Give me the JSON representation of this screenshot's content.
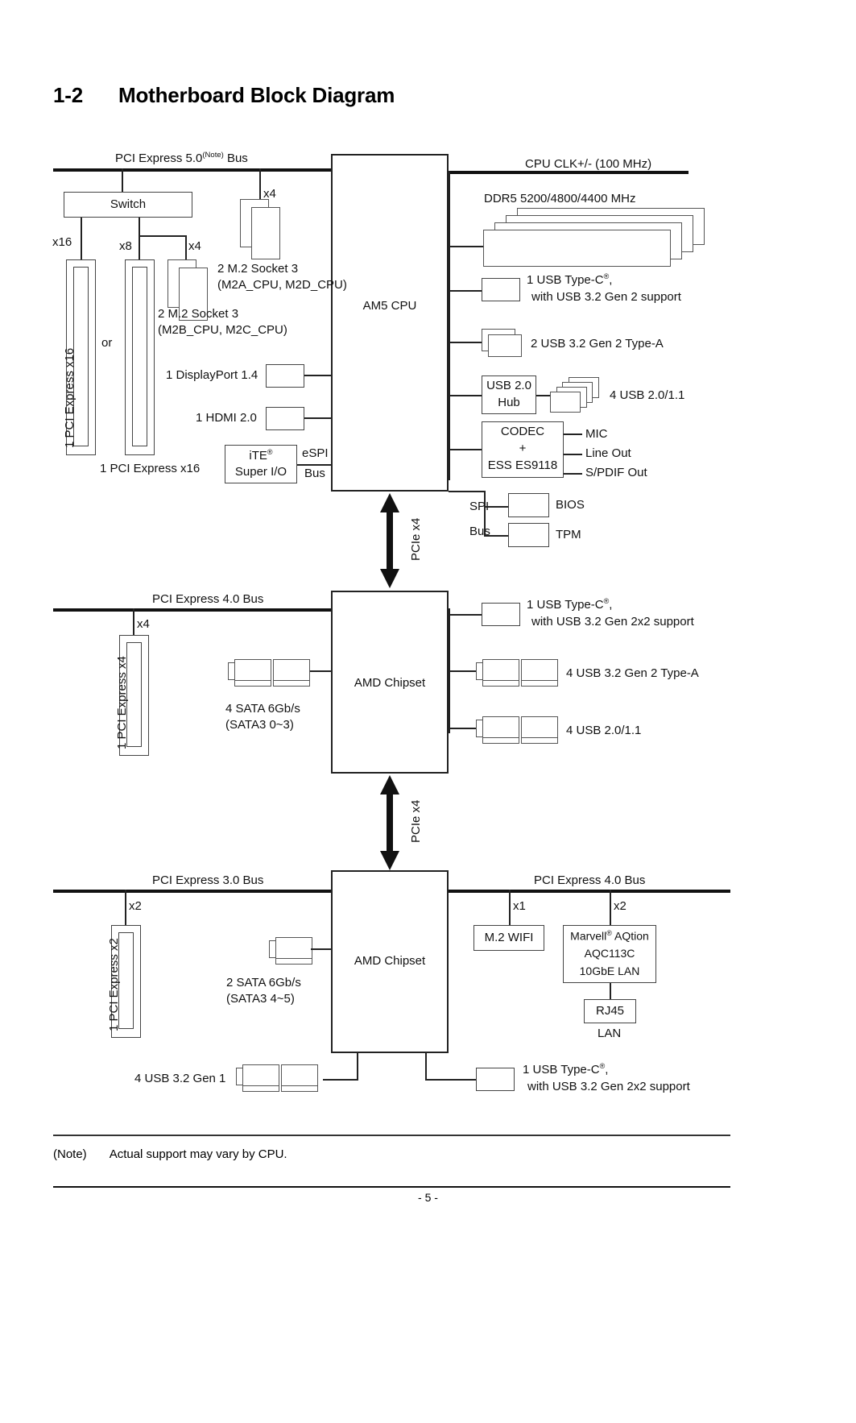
{
  "page": {
    "section_number": "1-2",
    "title": "Motherboard Block Diagram",
    "note_label": "(Note)",
    "note_text": "Actual support may vary by CPU.",
    "page_number": "- 5 -"
  },
  "cpu_section": {
    "bus_left_label": "PCI Express 5.0",
    "bus_left_label_sup": "(Note)",
    "bus_left_label_tail": " Bus",
    "bus_right_label": "CPU CLK+/- (100 MHz)",
    "cpu_block": "AM5 CPU",
    "switch_block": "Switch",
    "lane_x16": "x16",
    "lane_x8": "x8",
    "lane_x4_switch": "x4",
    "lane_x4_bus": "x4",
    "or_label": "or",
    "slot1_label": "1 PCI Express x16",
    "slot2_label": "1 PCI Express x16",
    "m2_a_line1": "2 M.2 Socket 3",
    "m2_a_line2": "(M2A_CPU, M2D_CPU)",
    "m2_b_line1": "2 M.2 Socket 3",
    "m2_b_line2": "(M2B_CPU, M2C_CPU)",
    "displayport": "1 DisplayPort 1.4",
    "hdmi": "1 HDMI 2.0",
    "super_io_line1": "iTE",
    "super_io_sup": "®",
    "super_io_line2": "Super I/O",
    "espi_line1": "eSPI",
    "espi_line2": "Bus",
    "memory": "DDR5 5200/4800/4400 MHz",
    "usb_c_line1": "1 USB Type-C",
    "usb_c_sup": "®",
    "usb_c_line1_tail": ",",
    "usb_c_line2": "with USB 3.2 Gen 2 support",
    "usb_a_label": "2 USB 3.2 Gen 2 Type-A",
    "usb_hub_line1": "USB 2.0",
    "usb_hub_line2": "Hub",
    "usb_20_label": "4 USB 2.0/1.1",
    "codec_line1": "CODEC",
    "codec_line2": "+",
    "codec_line3": "ESS ES9118",
    "audio_mic": "MIC",
    "audio_lineout": "Line Out",
    "audio_spdif": "S/PDIF Out",
    "spi_line1": "SPI",
    "spi_line2": "Bus",
    "bios": "BIOS",
    "tpm": "TPM"
  },
  "link_upper": {
    "label": "PCIe x4"
  },
  "chipset_mid": {
    "bus_label": "PCI Express 4.0 Bus",
    "block": "AMD Chipset",
    "lane_x4": "x4",
    "slot_label": "1 PCI Express x4",
    "sata_line1": "4 SATA 6Gb/s",
    "sata_line2": "(SATA3 0~3)",
    "usb_c_line1": "1 USB Type-C",
    "usb_c_sup": "®",
    "usb_c_line1_tail": ",",
    "usb_c_line2": "with USB 3.2 Gen 2x2 support",
    "usb_a_label": "4 USB 3.2 Gen 2 Type-A",
    "usb_20_label": "4 USB 2.0/1.1"
  },
  "link_lower": {
    "label": "PCIe x4"
  },
  "chipset_bottom": {
    "bus_left_label": "PCI Express 3.0 Bus",
    "bus_right_label": "PCI Express 4.0 Bus",
    "block": "AMD Chipset",
    "lane_x2_left": "x2",
    "slot_label": "1 PCI Express x2",
    "sata_line1": "2 SATA 6Gb/s",
    "sata_line2": "(SATA3 4~5)",
    "lane_x1": "x1",
    "lane_x2_right": "x2",
    "wifi": "M.2 WIFI",
    "lan_line1": "Marvell",
    "lan_sup": "®",
    "lan_line1_tail": " AQtion",
    "lan_line2": "AQC113C",
    "lan_line3": "10GbE LAN",
    "rj45": "RJ45",
    "lan_label": "LAN",
    "usb_gen1_label": "4 USB 3.2 Gen 1",
    "usb_c_line1": "1 USB Type-C",
    "usb_c_sup": "®",
    "usb_c_line1_tail": ",",
    "usb_c_line2": "with USB 3.2 Gen 2x2 support"
  },
  "colors": {
    "line": "#222222",
    "box_border": "#444444",
    "text": "#111111"
  }
}
